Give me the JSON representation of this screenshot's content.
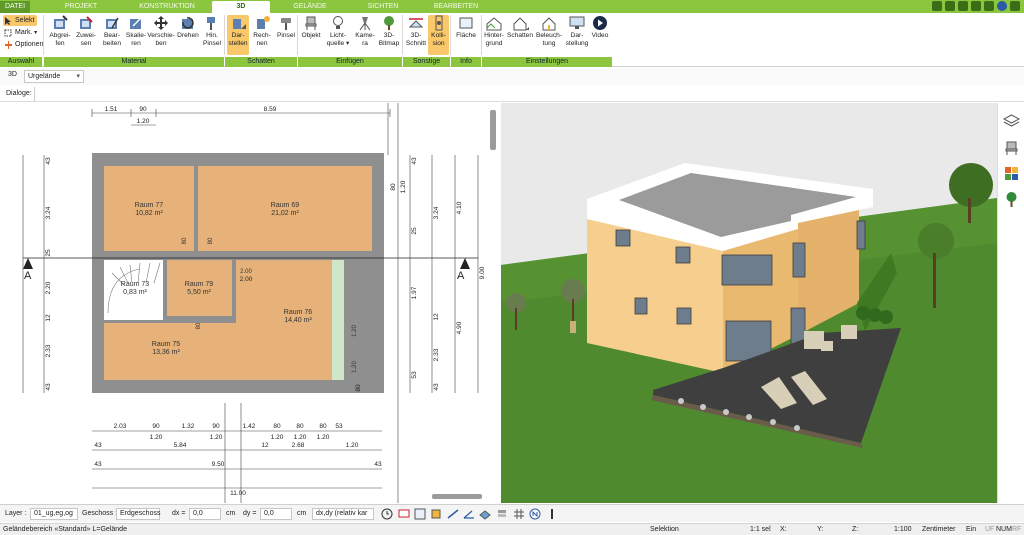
{
  "tabs": [
    "DATEI",
    "PROJEKT",
    "KONSTRUKTION",
    "3D",
    "GELÄNDE",
    "SICHTEN",
    "BEARBEITEN"
  ],
  "ribbon": {
    "auswahl": {
      "items": [
        "Selekt",
        "Mark.",
        "Optionen"
      ],
      "label": "Auswahl"
    },
    "material": {
      "buttons": [
        "Abgrei-\nfen",
        "Zuwei-\nsen",
        "Bear-\nbeiten",
        "Skalie-\nren",
        "Verschie-\nben",
        "Drehen",
        "Hin.\nPinsel"
      ],
      "label": "Material"
    },
    "schatten": {
      "buttons": [
        "Dar-\nstellen",
        "Rech-\nnen",
        "Pinsel"
      ],
      "label": "Schatten"
    },
    "einfuegen": {
      "buttons": [
        "Objekt",
        "Licht-\nquelle ▾",
        "Kame-\nra",
        "3D-\nBitmap"
      ],
      "label": "Einfügen"
    },
    "sonstige": {
      "buttons": [
        "3D-\nSchnitt",
        "Kolli-\nsion"
      ],
      "label": "Sonstige"
    },
    "info": {
      "buttons": [
        "Fläche"
      ],
      "label": "Info"
    },
    "einstellungen": {
      "buttons": [
        "Hinter-\ngrund",
        "Schatten",
        "Beleuch-\ntung",
        "Dar-\nstellung",
        "Video"
      ],
      "label": "Einstellungen"
    }
  },
  "view_row": {
    "mode": "3D",
    "terrain": "Urgelände"
  },
  "dialoge": "Dialoge:",
  "plan": {
    "rooms": [
      {
        "name": "Raum 77",
        "area": "10,82 m²"
      },
      {
        "name": "Raum 69",
        "area": "21,02 m²"
      },
      {
        "name": "Raum 73",
        "area": "0,83 m²"
      },
      {
        "name": "Raum 79",
        "area": "5,50 m²"
      },
      {
        "name": "Raum 76",
        "area": "14,40 m²"
      },
      {
        "name": "Raum 75",
        "area": "13,36 m²"
      }
    ],
    "top_dims": [
      "1.51",
      "90",
      "8.59",
      "1.20"
    ],
    "left_dims": [
      "43",
      "3.24",
      "25",
      "2.20",
      "12",
      "2.33",
      "43"
    ],
    "right_dims": [
      "43",
      "3.24",
      "25",
      "1.97",
      "12",
      "2.33",
      "53",
      "43",
      "4.10",
      "4.90",
      "9.00",
      "80",
      "1.20"
    ],
    "bottom_dims_1": [
      "2.03",
      "90",
      "1.32",
      "90",
      "1.42",
      "80",
      "80",
      "80",
      "53",
      "1.20",
      "1.20",
      "1.20",
      "1.20",
      "1.20"
    ],
    "bottom_dims_2": [
      "43",
      "5.84",
      "12",
      "2.68",
      "1.20",
      "80",
      "2.00"
    ],
    "bottom_dims_3": [
      "43",
      "9.50",
      "43"
    ],
    "bottom_dims_4": [
      "11.00"
    ],
    "section_label": "A",
    "door_dims": [
      "80",
      "2.00",
      "1.20"
    ]
  },
  "bottom": {
    "layer_label": "Layer :",
    "layer_value": "01_ug,eg,og",
    "geschoss_label": "Geschoss :",
    "geschoss_value": "Erdgeschoss",
    "dx_label": "dx =",
    "dx_value": "0,0",
    "dy_label": "dy =",
    "dy_value": "0,0",
    "unit": "cm",
    "mode_value": "dx,dy (relativ kar"
  },
  "status": {
    "left": "Geländebereich «Standard» L=Gelände",
    "selektion": "Selektion",
    "sel": "1:1 sel",
    "x": "X:",
    "y": "Y:",
    "z": "Z:",
    "scale": "1:100",
    "unit": "Zentimeter",
    "ein": "Ein",
    "ufi": "UF",
    "num": "NUM",
    "rf": "RF"
  },
  "colors": {
    "ribbon_green": "#8cc63f",
    "active_orange": "#f8c86a",
    "wall_gray": "#8f8f8f",
    "floor_wood": "#e6b27a",
    "grass": "#4f8a2e",
    "sky": "#e8e8e8"
  }
}
